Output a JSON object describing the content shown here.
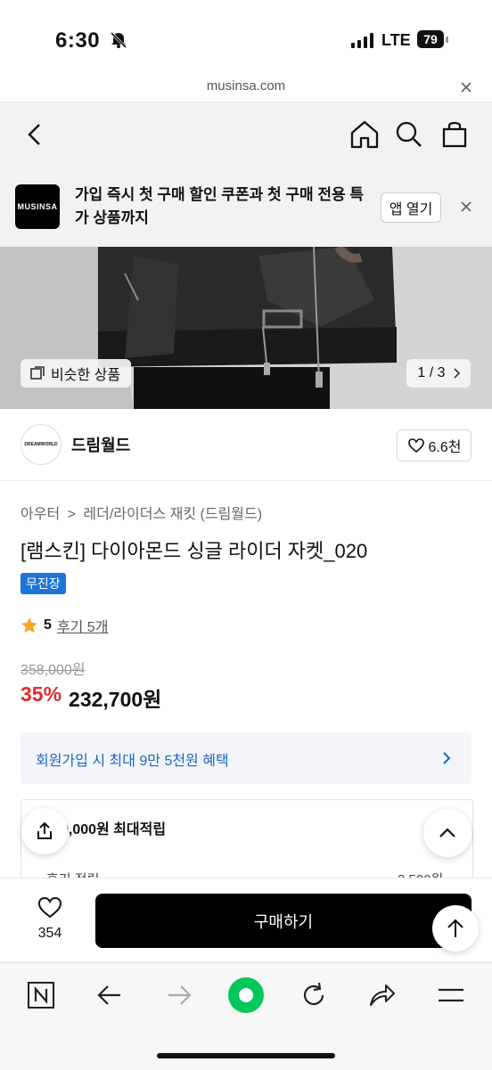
{
  "status": {
    "time": "6:30",
    "network": "LTE",
    "battery": "79"
  },
  "browser": {
    "url": "musinsa.com"
  },
  "banner": {
    "logo": "MUSINSA",
    "text": "가입 즉시 첫 구매 할인 쿠폰과 첫 구매 전용 특가 상품까지",
    "open_app": "앱 열기"
  },
  "hero": {
    "similar_label": "비슷한 상품",
    "pager": "1 / 3"
  },
  "brand": {
    "logo_text": "DREAMWORLD",
    "name": "드림월드",
    "likes": "6.6천"
  },
  "product": {
    "category": "아우터",
    "subcategory": "레더/라이더스 재킷 (드림월드)",
    "title": "[램스킨] 다이아몬드 싱글 라이더 자켓_020",
    "badge": "무진장",
    "rating": "5",
    "reviews": "후기 5개",
    "original_price": "358,000원",
    "discount": "35%",
    "price": "232,700원"
  },
  "member_benefit": "회원가입 시 최대 9만 5천원 혜택",
  "points": {
    "title": "9,000원 최대적립",
    "row_label": "후기 적립",
    "row_value": "2,500원"
  },
  "buy": {
    "wish_count": "354",
    "buy_label": "구매하기"
  },
  "colors": {
    "accent_blue": "#1e75d8",
    "discount_red": "#e02b2b",
    "naver_green": "#03c75a"
  }
}
